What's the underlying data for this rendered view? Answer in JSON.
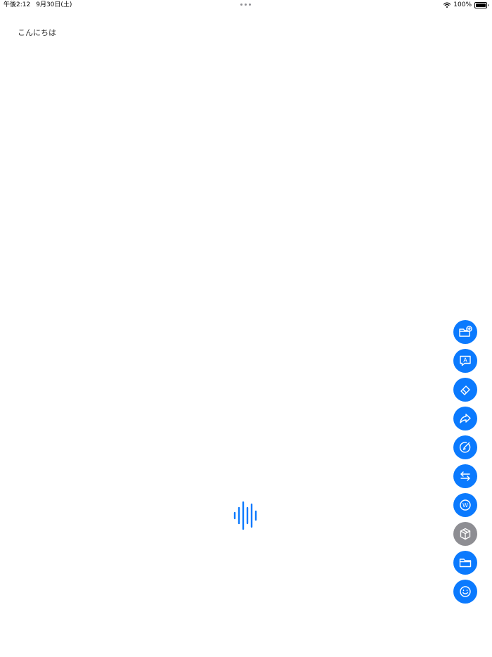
{
  "status_bar": {
    "time": "午後2:12",
    "date": "9月30日(土)",
    "battery_percent": "100%",
    "battery_level": 1.0
  },
  "document": {
    "text": "こんにちは"
  },
  "colors": {
    "accent": "#0b7afe",
    "disabled": "#8e8e93",
    "background": "#ffffff"
  },
  "toolbar": {
    "buttons": [
      {
        "icon": "folder-plus-icon",
        "enabled": true
      },
      {
        "icon": "speech-bubble-a-icon",
        "enabled": true
      },
      {
        "icon": "eraser-icon",
        "enabled": true
      },
      {
        "icon": "share-arrow-icon",
        "enabled": true
      },
      {
        "icon": "pen-circle-icon",
        "enabled": true
      },
      {
        "icon": "swap-arrows-icon",
        "enabled": true
      },
      {
        "icon": "w-circle-icon",
        "enabled": true,
        "glyph": "W"
      },
      {
        "icon": "cube-icon",
        "enabled": false
      },
      {
        "icon": "folder-icon",
        "enabled": true
      },
      {
        "icon": "smiley-icon",
        "enabled": true
      }
    ]
  },
  "icons": {
    "voice": "waveform-icon",
    "network": "wifi-icon",
    "power": "battery-icon"
  }
}
